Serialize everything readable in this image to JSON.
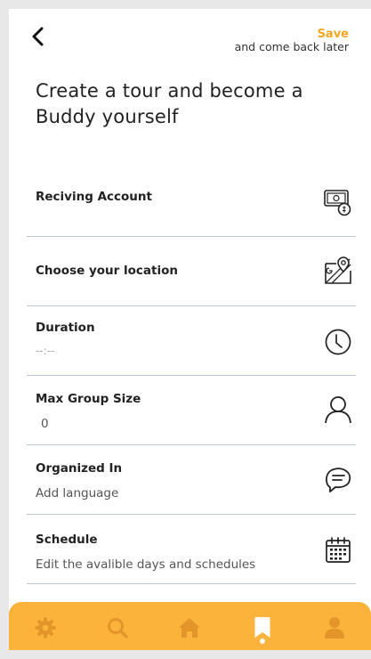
{
  "header": {
    "save_label": "Save",
    "save_sub": "and come back later",
    "title": "Create a tour and become a Buddy yourself"
  },
  "form": {
    "receiving_account": {
      "label": "Reciving Account",
      "icon": "money-icon"
    },
    "location": {
      "label": "Choose your location",
      "icon": "map-icon"
    },
    "duration": {
      "label": "Duration",
      "value": "--:--",
      "icon": "clock-icon"
    },
    "max_group": {
      "label": "Max Group Size",
      "value": "0",
      "icon": "person-icon"
    },
    "organized_in": {
      "label": "Organized In",
      "value": "Add language",
      "icon": "chat-icon"
    },
    "schedule": {
      "label": "Schedule",
      "value": "Edit the avalible days and schedules",
      "icon": "calendar-icon"
    }
  },
  "nav": {
    "items": [
      "settings",
      "search",
      "home",
      "bookmark",
      "profile"
    ],
    "active": "bookmark",
    "bg_color": "#fbb33b",
    "inactive_color": "#e3952a",
    "active_color": "#ffffff"
  },
  "colors": {
    "accent": "#f5a623",
    "divider": "#bfc6d6"
  }
}
